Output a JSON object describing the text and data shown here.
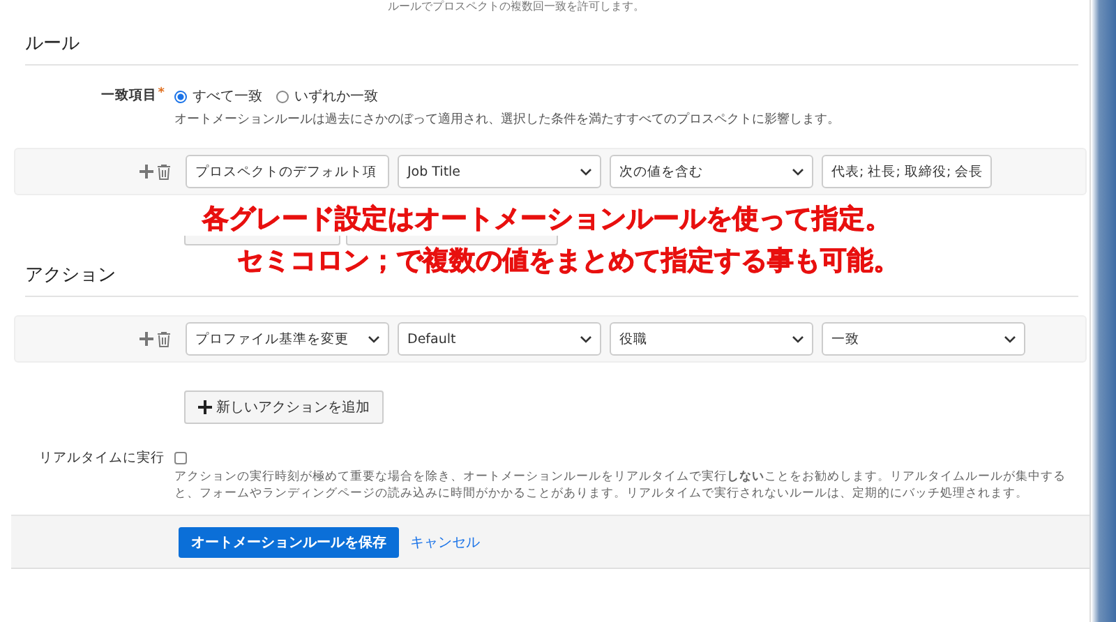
{
  "intro_text": "ルールでプロスペクトの複数回一致を許可します。",
  "rules_section": {
    "heading": "ルール",
    "match": {
      "label": "一致項目",
      "required_mark": "*",
      "options": [
        {
          "label": "すべて一致",
          "selected": true
        },
        {
          "label": "いずれか一致",
          "selected": false
        }
      ],
      "note": "オートメーションルールは過去にさかのぼって適用され、選択した条件を満たすすべてのプロスペクトに影響します。"
    },
    "rule_rows": [
      {
        "fields": [
          {
            "kind": "select",
            "value": "プロスペクトのデフォルト項"
          },
          {
            "kind": "select",
            "value": "Job Title"
          },
          {
            "kind": "select",
            "value": "次の値を含む"
          },
          {
            "kind": "text",
            "value": "代表; 社長; 取締役; 会長"
          }
        ]
      }
    ]
  },
  "annotation": {
    "lines": [
      "各グレード設定はオートメーションルールを使って指定。",
      "セミコロン；で複数の値をまとめて指定する事も可能。"
    ]
  },
  "actions_section": {
    "heading": "アクション",
    "action_rows": [
      {
        "fields": [
          {
            "kind": "select",
            "value": "プロファイル基準を変更"
          },
          {
            "kind": "select",
            "value": "Default"
          },
          {
            "kind": "select",
            "value": "役職"
          },
          {
            "kind": "select",
            "value": "一致"
          }
        ]
      }
    ],
    "add_button": "新しいアクションを追加"
  },
  "realtime": {
    "label": "リアルタイムに実行",
    "checked": false,
    "description": "アクションの実行時刻が極めて重要な場合を除き、オートメーションルールをリアルタイムで実行**しない**ことをお勧めします。リアルタイムルールが集中すると、フォームやランディングページの読み込みに時間がかかることがあります。リアルタイムで実行されないルールは、定期的にバッチ処理されます。"
  },
  "footer": {
    "save_button": "オートメーションルールを保存",
    "cancel_link": "キャンセル"
  }
}
